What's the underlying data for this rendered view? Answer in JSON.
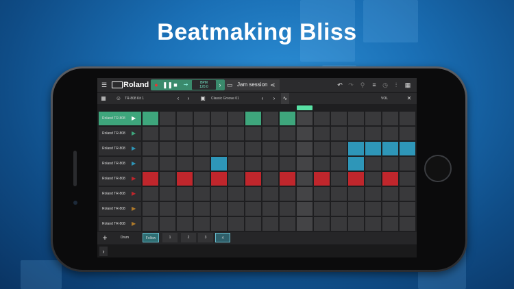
{
  "headline": "Beatmaking Bliss",
  "toolbar": {
    "menu_icon": "☰",
    "brand": "Roland",
    "transport": {
      "record_icon": "●",
      "pause_icon": "❚❚",
      "stop_icon": "■",
      "tempo_icon": "⇝"
    },
    "bpm_label": "BPM",
    "bpm_value": "120.0",
    "next_icon": "›",
    "project_icon": "▭",
    "project_name": "Jam session",
    "share_icon": "⋖",
    "undo_icon": "↶",
    "redo_icon": "↷",
    "tool_icon": "⚲",
    "eq_icon": "≡",
    "clock_icon": "◷",
    "mixer_icon": "⫶",
    "grid_icon": "▦"
  },
  "patternbar": {
    "view_icon": "▦",
    "kit_icon": "☺",
    "kit_name": "TR-808 Kit 1",
    "prev": "‹",
    "next": "›",
    "pattern_icon": "▣",
    "pattern_name": "Classic Groove 01",
    "automation_icon": "∿",
    "volume_icon": "VOL",
    "close_icon": "✕"
  },
  "tracks": [
    {
      "name": "Roland TR-808",
      "color": "#3ea67c",
      "selected": true,
      "steps": [
        1,
        0,
        0,
        0,
        0,
        0,
        1,
        0,
        1,
        0,
        0,
        0,
        0,
        0,
        0,
        0
      ]
    },
    {
      "name": "Roland TR-808",
      "color": "#3ea67c",
      "selected": false,
      "steps": [
        0,
        0,
        0,
        0,
        0,
        0,
        0,
        0,
        0,
        0,
        0,
        0,
        0,
        0,
        0,
        0
      ]
    },
    {
      "name": "Roland TR-808",
      "color": "#2e96b8",
      "selected": false,
      "steps": [
        0,
        0,
        0,
        0,
        0,
        0,
        0,
        0,
        0,
        0,
        0,
        0,
        1,
        1,
        1,
        1
      ]
    },
    {
      "name": "Roland TR-808",
      "color": "#2e96b8",
      "selected": false,
      "steps": [
        0,
        0,
        0,
        0,
        1,
        0,
        0,
        0,
        0,
        0,
        0,
        0,
        1,
        0,
        0,
        0
      ]
    },
    {
      "name": "Roland TR-808",
      "color": "#c0262c",
      "selected": false,
      "steps": [
        1,
        0,
        1,
        0,
        1,
        0,
        1,
        0,
        1,
        0,
        1,
        0,
        1,
        0,
        1,
        0
      ]
    },
    {
      "name": "Roland TR-808",
      "color": "#c0262c",
      "selected": false,
      "steps": [
        0,
        0,
        0,
        0,
        0,
        0,
        0,
        0,
        0,
        0,
        0,
        0,
        0,
        0,
        0,
        0
      ]
    },
    {
      "name": "Roland TR-808",
      "color": "#b07a2a",
      "selected": false,
      "steps": [
        0,
        0,
        0,
        0,
        0,
        0,
        0,
        0,
        0,
        0,
        0,
        0,
        0,
        0,
        0,
        0
      ]
    },
    {
      "name": "Roland TR-808",
      "color": "#b07a2a",
      "selected": false,
      "steps": [
        0,
        0,
        0,
        0,
        0,
        0,
        0,
        0,
        0,
        0,
        0,
        0,
        0,
        0,
        0,
        0
      ]
    }
  ],
  "playhead_step": 9,
  "bottombar": {
    "add_icon": "+",
    "sound_label": "Drum Sound",
    "follow_label": "Follow",
    "pages": [
      "1",
      "2",
      "3",
      "4"
    ],
    "active_page": "4",
    "expand_icon": "›"
  }
}
